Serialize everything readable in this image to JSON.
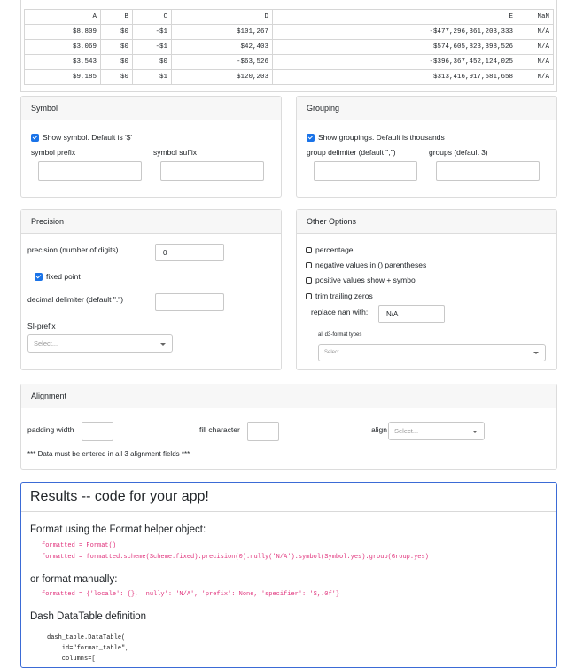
{
  "table": {
    "headers": [
      "A",
      "B",
      "C",
      "D",
      "E",
      "NaN"
    ],
    "rows": [
      [
        "$8,809",
        "$0",
        "-$1",
        "$101,267",
        "-$477,296,361,203,333",
        "N/A"
      ],
      [
        "$3,069",
        "$0",
        "-$1",
        "$42,403",
        "$574,605,823,398,526",
        "N/A"
      ],
      [
        "$3,543",
        "$0",
        "$0",
        "-$63,526",
        "-$396,367,452,124,025",
        "N/A"
      ],
      [
        "$9,185",
        "$0",
        "$1",
        "$120,203",
        "$313,416,917,581,658",
        "N/A"
      ]
    ]
  },
  "symbol": {
    "title": "Symbol",
    "checkbox_label": "Show symbol. Default is '$'",
    "prefix_label": "symbol prefix",
    "suffix_label": "symbol suffix",
    "prefix_value": "",
    "suffix_value": ""
  },
  "grouping": {
    "title": "Grouping",
    "checkbox_label": "Show groupings. Default is thousands",
    "delimiter_label": "group delimiter (default \",\")",
    "groups_label": "groups (default 3)",
    "delimiter_value": "",
    "groups_value": ""
  },
  "precision": {
    "title": "Precision",
    "digits_label": "precision (number of digits)",
    "digits_value": "0",
    "fixed_label": "fixed point",
    "decimal_label": "decimal delimiter (default \".\")",
    "decimal_value": "",
    "si_label": "SI-prefix",
    "si_placeholder": "Select..."
  },
  "other": {
    "title": "Other Options",
    "options": [
      "percentage",
      "negative values in () parentheses",
      "positive values show + symbol",
      "trim trailing zeros"
    ],
    "nan_label": "replace nan with:",
    "nan_value": "N/A",
    "d3_label": "all d3-format types",
    "d3_placeholder": "Select..."
  },
  "alignment": {
    "title": "Alignment",
    "padding_label": "padding width",
    "fill_label": "fill character",
    "align_label": "align",
    "align_placeholder": "Select...",
    "note": "*** Data must be entered in all 3 alignment fields ***"
  },
  "results": {
    "title": "Results -- code for your app!",
    "format_helper_heading": "Format using the Format helper object:",
    "code_line1": "formatted = Format()",
    "code_line2": "formatted = formatted.scheme(Scheme.fixed).precision(0).nully('N/A').symbol(Symbol.yes).group(Group.yes)",
    "manual_heading": "or format manually:",
    "manual_code": "formatted = {'locale': {}, 'nully': 'N/A', 'prefix': None, 'specifier': '$,.0f'}",
    "datatable_heading": "Dash DataTable definition",
    "dt_line1": "dash_table.DataTable(",
    "dt_line2": "    id=\"format_table\",",
    "dt_line3": "    columns=["
  },
  "colors": {
    "checkbox_on": "#1a73e8",
    "results_border": "#3b6bd6",
    "code_pink": "#e0337c"
  }
}
